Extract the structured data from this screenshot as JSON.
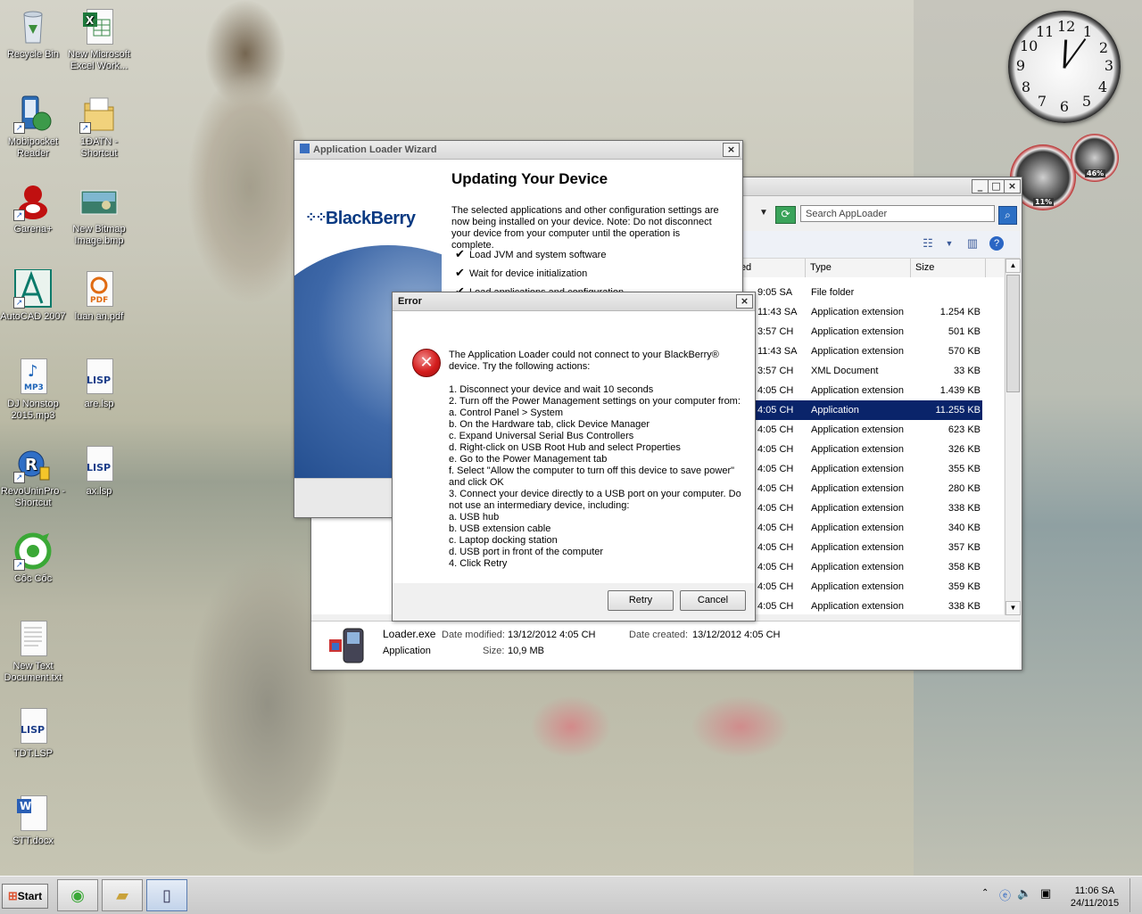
{
  "desktop": {
    "icons": [
      {
        "label": "Recycle Bin"
      },
      {
        "label": "New Microsoft Excel Work..."
      },
      {
        "label": "Mobipocket Reader"
      },
      {
        "label": "1ĐATN - Shortcut"
      },
      {
        "label": "Garena+"
      },
      {
        "label": "New Bitmap Image.bmp"
      },
      {
        "label": "AutoCAD 2007"
      },
      {
        "label": "luan an.pdf"
      },
      {
        "label": "DJ Nonstop 2015.mp3"
      },
      {
        "label": "are.lsp"
      },
      {
        "label": "RevoUninPro - Shortcut"
      },
      {
        "label": "ax.lsp"
      },
      {
        "label": "Cốc Cốc"
      },
      {
        "label": "New Text Document.txt"
      },
      {
        "label": "TDT.LSP"
      },
      {
        "label": "STT.docx"
      }
    ],
    "badges": {
      "pdf": "PDF",
      "mp3": "MP3",
      "lisp": "LISP",
      "word": "W"
    }
  },
  "gadgets": {
    "clock_numbers": [
      "12",
      "1",
      "2",
      "3",
      "4",
      "5",
      "6",
      "7",
      "8",
      "9",
      "10",
      "11"
    ],
    "cpu_percent": "11%",
    "mem_percent": "46%"
  },
  "explorer": {
    "search_placeholder": "Search AppLoader",
    "columns": {
      "modified": "ified",
      "type": "Type",
      "size": "Size"
    },
    "rows": [
      {
        "time": "9:05 SA",
        "type": "File folder",
        "size": ""
      },
      {
        "time": "11:43 SA",
        "type": "Application extension",
        "size": "1.254 KB"
      },
      {
        "time": "3:57 CH",
        "type": "Application extension",
        "size": "501 KB"
      },
      {
        "time": "11:43 SA",
        "type": "Application extension",
        "size": "570 KB"
      },
      {
        "time": "3:57 CH",
        "type": "XML Document",
        "size": "33 KB"
      },
      {
        "time": "4:05 CH",
        "type": "Application extension",
        "size": "1.439 KB"
      },
      {
        "time": "4:05 CH",
        "type": "Application",
        "size": "11.255 KB"
      },
      {
        "time": "4:05 CH",
        "type": "Application extension",
        "size": "623 KB"
      },
      {
        "time": "4:05 CH",
        "type": "Application extension",
        "size": "326 KB"
      },
      {
        "time": "4:05 CH",
        "type": "Application extension",
        "size": "355 KB"
      },
      {
        "time": "4:05 CH",
        "type": "Application extension",
        "size": "280 KB"
      },
      {
        "time": "4:05 CH",
        "type": "Application extension",
        "size": "338 KB"
      },
      {
        "time": "4:05 CH",
        "type": "Application extension",
        "size": "340 KB"
      },
      {
        "time": "4:05 CH",
        "type": "Application extension",
        "size": "357 KB"
      },
      {
        "time": "4:05 CH",
        "type": "Application extension",
        "size": "358 KB"
      },
      {
        "time": "4:05 CH",
        "type": "Application extension",
        "size": "359 KB"
      },
      {
        "time": "4:05 CH",
        "type": "Application extension",
        "size": "338 KB"
      }
    ],
    "details": {
      "filename": "Loader.exe",
      "kind": "Application",
      "modified_label": "Date modified:",
      "modified_value": "13/12/2012 4:05 CH",
      "created_label": "Date created:",
      "created_value": "13/12/2012 4:05 CH",
      "size_label": "Size:",
      "size_value": "10,9 MB"
    }
  },
  "wizard": {
    "title": "Application Loader Wizard",
    "logo": "BlackBerry",
    "heading": "Updating Your Device",
    "description": "The selected applications and other configuration settings are now being installed on your device. Note: Do not disconnect your device from your computer until the operation is complete.",
    "steps": [
      "Load JVM and system software",
      "Wait for device initialization",
      "Load applications and configuration"
    ]
  },
  "error_dialog": {
    "title": "Error",
    "message": "The Application Loader could not connect to your BlackBerry® device. Try the following actions:\n\n1. Disconnect your device and wait 10 seconds\n2. Turn off the Power Management settings on your computer from:\n                a. Control Panel > System\n                b. On the Hardware tab, click Device Manager\n                c. Expand Universal Serial Bus Controllers\n                d. Right-click on USB Root Hub and select Properties\n                e. Go to the Power Management tab\n                f. Select \"Allow the computer to turn off this device to save power\" and click OK\n3. Connect your device directly to a USB port on your computer. Do not use an intermediary device, including:\n                a. USB hub\n                b. USB extension cable\n                c. Laptop docking station\n                d. USB port in front of the computer\n4. Click Retry",
    "retry_label": "Retry",
    "cancel_label": "Cancel"
  },
  "taskbar": {
    "start_label": "Start",
    "time": "11:06 SA",
    "date": "24/11/2015"
  }
}
